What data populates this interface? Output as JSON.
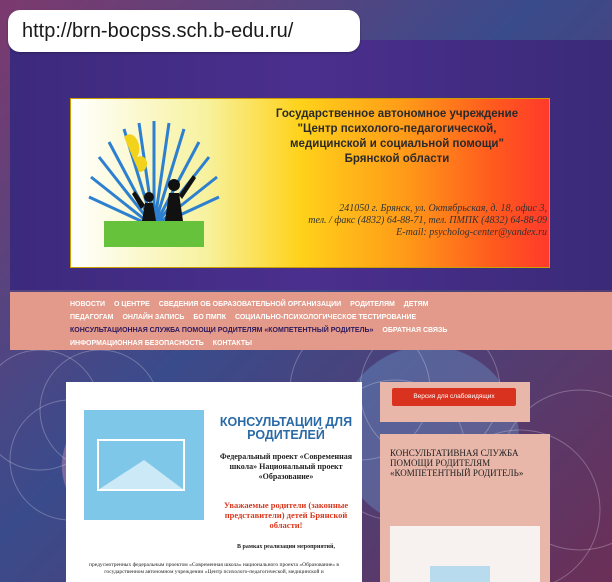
{
  "url": "http://brn-bocpss.sch.b-edu.ru/",
  "banner": {
    "title_lines": [
      "Государственное автономное учреждение",
      "\"Центр психолого-педагогической,",
      "медицинской и социальной помощи\"",
      "Брянской области"
    ],
    "address_lines": [
      "241050 г. Брянск, ул. Октябрьская, д. 18, офис 3,",
      "тел. / факс (4832) 64-88-71, тел. ПМПК (4832) 64-88-09",
      "E-mail: psycholog-center@yandex.ru"
    ]
  },
  "nav": {
    "items": [
      "Новости",
      "О центре",
      "Сведения об образовательной организации",
      "Родителям",
      "Детям",
      "Педагогам",
      "Онлайн запись",
      "Бо ПМПК",
      "Социально-психологическое тестирование",
      "Консультационная служба помощи родителям «Компетентный родитель»",
      "Обратная связь",
      "Информационная безопасность",
      "Контакты"
    ]
  },
  "content": {
    "title": "КОНСУЛЬТАЦИИ ДЛЯ РОДИТЕЛЕЙ",
    "project": "Федеральный проект «Современная школа» Национальный проект «Образование»",
    "red_text": "Уважаемые родители (законные представители) детей Брянской области!",
    "note": "В рамках реализации мероприятий,",
    "body": "предусмотренных федеральным проектом «Современная школа» национального проекта «Образование» в государственном автономном учреждении «Центр психолого-педагогической, медицинской и"
  },
  "sidebar": {
    "vision_button": "Версия для слабовидящих",
    "card_title": "Консультативная служба помощи родителям «Компетентный родитель»"
  },
  "colors": {
    "banner_bg": "#3c2a7d",
    "nav_bg": "#e39a8a",
    "accent_red": "#d9321f",
    "title_blue": "#2a6aa6"
  }
}
